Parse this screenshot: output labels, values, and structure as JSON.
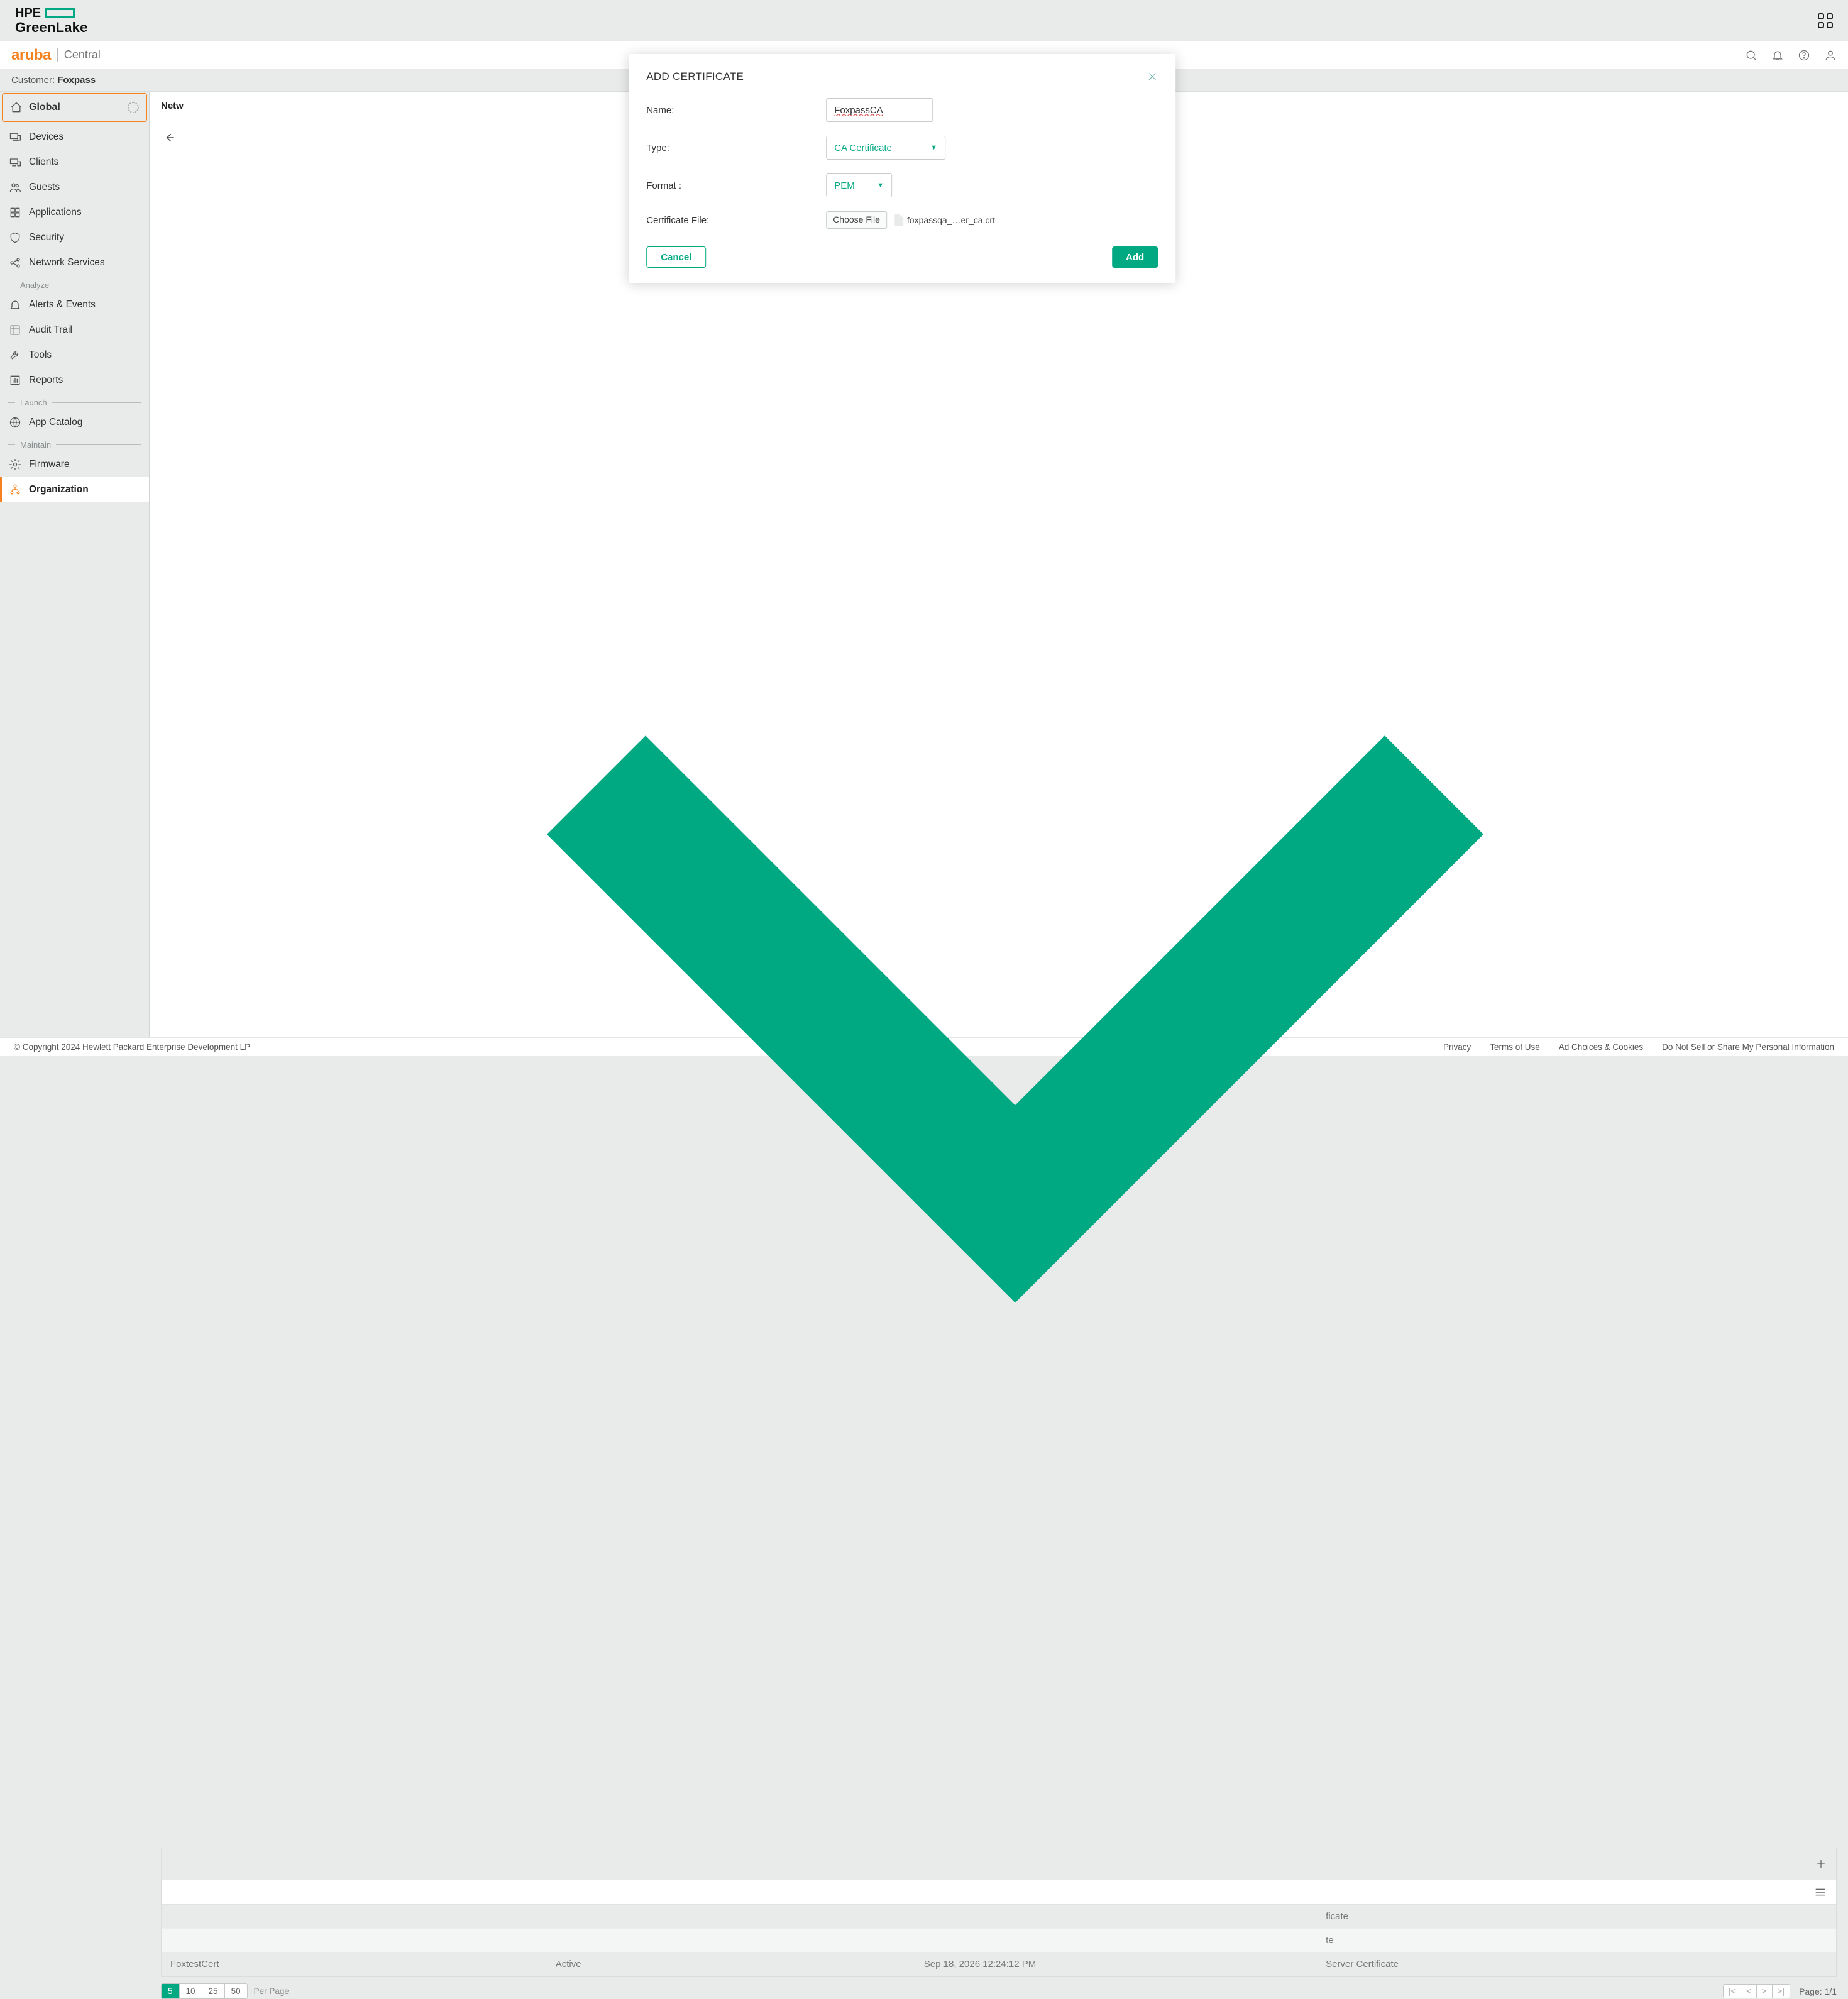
{
  "greenlake": {
    "brand_top": "HPE",
    "brand_bottom": "GreenLake"
  },
  "aruba": {
    "brand": "aruba",
    "product": "Central"
  },
  "customer": {
    "label": "Customer:",
    "name": "Foxpass"
  },
  "global_selector": {
    "label": "Global"
  },
  "sidebar": {
    "manage": [
      {
        "key": "overview",
        "label": "(overview)"
      },
      {
        "key": "devices",
        "label": "Devices"
      },
      {
        "key": "clients",
        "label": "Clients"
      },
      {
        "key": "guests",
        "label": "Guests"
      },
      {
        "key": "applications",
        "label": "Applications"
      },
      {
        "key": "security",
        "label": "Security"
      },
      {
        "key": "network-services",
        "label": "Network Services"
      }
    ],
    "sections": {
      "analyze": "Analyze",
      "launch": "Launch",
      "maintain": "Maintain"
    },
    "analyze": [
      {
        "key": "alerts",
        "label": "Alerts & Events"
      },
      {
        "key": "audit",
        "label": "Audit Trail"
      },
      {
        "key": "tools",
        "label": "Tools"
      },
      {
        "key": "reports",
        "label": "Reports"
      }
    ],
    "launch": [
      {
        "key": "app-catalog",
        "label": "App Catalog"
      }
    ],
    "maintain": [
      {
        "key": "firmware",
        "label": "Firmware"
      },
      {
        "key": "organization",
        "label": "Organization"
      }
    ]
  },
  "main": {
    "heading_truncated": "Netw",
    "table": {
      "rows": [
        {
          "name": "",
          "status": "",
          "expiry": "",
          "type": "ficate"
        },
        {
          "name": "",
          "status": "",
          "expiry": "",
          "type": "te"
        },
        {
          "name": "FoxtestCert",
          "status": "Active",
          "expiry": "Sep 18, 2026 12:24:12 PM",
          "type": "Server Certificate"
        }
      ]
    },
    "pager": {
      "sizes": [
        "5",
        "10",
        "25",
        "50"
      ],
      "active_size": "5",
      "per_page_label": "Per Page",
      "page_label": "Page: 1/1"
    }
  },
  "modal": {
    "title": "ADD CERTIFICATE",
    "fields": {
      "name_label": "Name:",
      "name_value": "FoxpassCA",
      "type_label": "Type:",
      "type_value": "CA Certificate",
      "format_label": "Format :",
      "format_value": "PEM",
      "file_label": "Certificate File:",
      "choose_file": "Choose File",
      "filename": "foxpassqa_…er_ca.crt"
    },
    "actions": {
      "cancel": "Cancel",
      "add": "Add"
    }
  },
  "footer": {
    "copyright": "© Copyright 2024 Hewlett Packard Enterprise Development LP",
    "links": [
      "Privacy",
      "Terms of Use",
      "Ad Choices & Cookies",
      "Do Not Sell or Share My Personal Information"
    ]
  }
}
